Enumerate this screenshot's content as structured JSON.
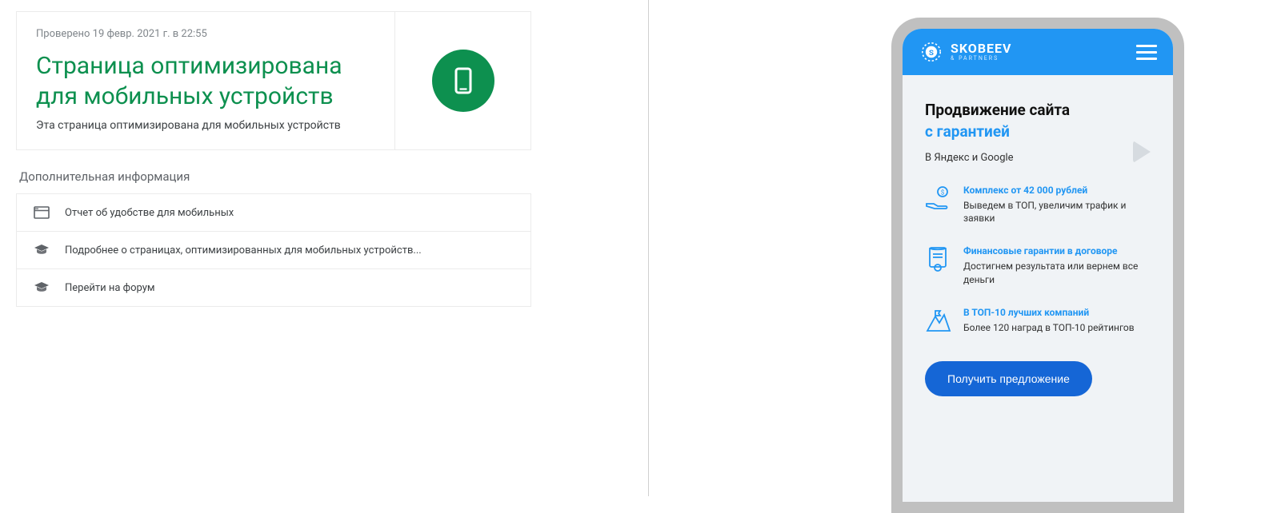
{
  "result": {
    "checked_at": "Проверено 19 февр. 2021 г. в 22:55",
    "verdict_title": "Страница оптимизирована для мобильных устройств",
    "verdict_sub": "Эта страница оптимизирована для мобильных устройств"
  },
  "more_info": {
    "heading": "Дополнительная информация",
    "rows": [
      {
        "icon": "browser",
        "label": "Отчет об удобстве для мобильных"
      },
      {
        "icon": "education",
        "label": "Подробнее о страницах, оптимизированных для мобильных устройств..."
      },
      {
        "icon": "education",
        "label": "Перейти на форум"
      }
    ]
  },
  "preview": {
    "brand_main": "SKOBEEV",
    "brand_sub": "& PARTNERS",
    "hero_line1": "Продвижение сайта",
    "hero_line2": "с гарантией",
    "hero_line3": "В Яндекс и Google",
    "features": [
      {
        "title": "Комплекс от 42 000 рублей",
        "desc": "Выведем в ТОП, увеличим трафик и заявки"
      },
      {
        "title": "Финансовые гарантии в договоре",
        "desc": "Достигнем результата или вернем все деньги"
      },
      {
        "title": "В ТОП-10 лучших компаний",
        "desc": "Более 120 наград в ТОП-10 рейтингов"
      }
    ],
    "cta": "Получить предложение"
  },
  "colors": {
    "success": "#0d904f",
    "brand_blue": "#2196f3",
    "cta_blue": "#1566d6"
  }
}
